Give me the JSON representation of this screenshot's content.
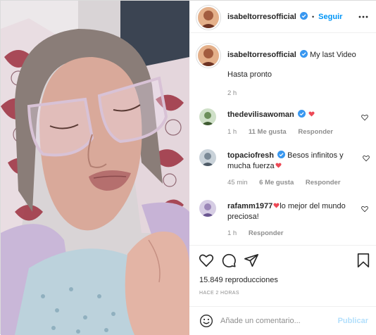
{
  "post": {
    "author": "isabeltorresofficial",
    "separator": "•",
    "follow_label": "Seguir",
    "more_icon": "more-horizontal-icon",
    "caption": {
      "username": "isabeltorresofficial",
      "text": "My last Video",
      "line2": "Hasta pronto",
      "time": "2 h"
    },
    "comments": [
      {
        "username": "thedevilisawoman",
        "text": "",
        "time": "1 h",
        "likes": "11 Me gusta",
        "reply": "Responder"
      },
      {
        "username": "topaciofresh",
        "text": "Besos infinitos y mucha fuerza",
        "time": "45 min",
        "likes": "6 Me gusta",
        "reply": "Responder"
      },
      {
        "username": "rafamm1977",
        "text_pre": "",
        "text": "lo mejor del mundo preciosa!",
        "time": "1 h",
        "reply": "Responder"
      }
    ],
    "views": "15.849 reproducciones",
    "posted_ago": "HACE 2 HORAS",
    "add_comment_placeholder": "Añade un comentario...",
    "publish_label": "Publicar"
  },
  "colors": {
    "link_blue": "#0095f6",
    "publish_disabled": "#b2dffc",
    "verified_blue": "#3897f0",
    "heart_red": "#ed4956",
    "muted": "#8e8e8e"
  },
  "icons": [
    "verified-badge-icon",
    "heart-icon",
    "comment-icon",
    "share-icon",
    "bookmark-icon",
    "smile-icon"
  ]
}
